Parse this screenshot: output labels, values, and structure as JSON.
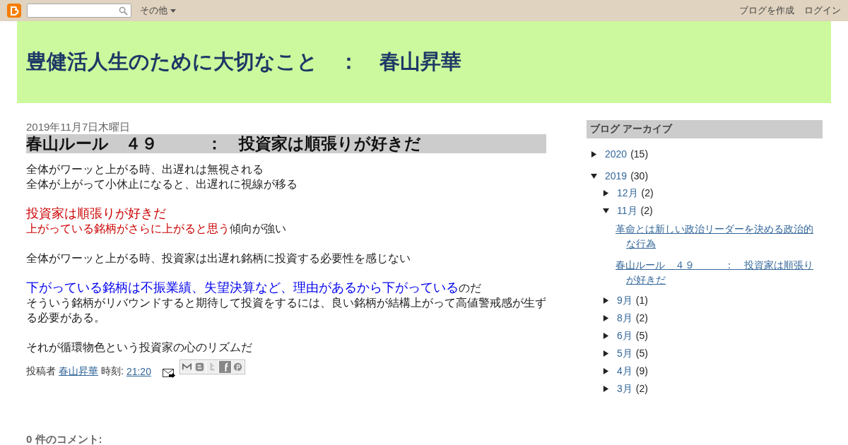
{
  "navbar": {
    "more": "その他",
    "links": [
      "ブログを作成",
      "ログイン"
    ]
  },
  "header": {
    "title": "豊健活人生のために大切なこと　：　春山昇華"
  },
  "post": {
    "date": "2019年11月7日木曜日",
    "title": "春山ルール　４９　　　：　投資家は順張りが好きだ",
    "paragraphs": [
      [
        [
          {
            "text": "全体がワーッと上がる時、出遅れは無視される",
            "kind": "plain"
          }
        ],
        [
          {
            "text": "全体が上がって小休止になると、出遅れに視線が移る",
            "kind": "plain"
          }
        ]
      ],
      [
        [
          {
            "text": "投資家は順張りが好きだ",
            "kind": "accent",
            "color": "#cc0000"
          }
        ],
        [
          {
            "text": "上がっている銘柄がさらに上がると思う",
            "kind": "colored",
            "color": "#cc0000"
          },
          {
            "text": "傾向が強い",
            "kind": "plain"
          }
        ]
      ],
      [
        [
          {
            "text": "全体がワーッと上がる時、投資家は出遅れ銘柄に投資する必要性を感じない",
            "kind": "plain"
          }
        ]
      ],
      [
        [
          {
            "text": "下がっている銘柄は不振業績、失望決算など、理由があるから下がっている",
            "kind": "accent",
            "color": "#0000ee"
          },
          {
            "text": "のだ",
            "kind": "plain"
          }
        ],
        [
          {
            "text": "そういう銘柄がリバウンドすると期待して投資をするには、良い銘柄が結構上がって高値警戒感が生ずる必要がある。",
            "kind": "plain"
          }
        ]
      ],
      [
        [
          {
            "text": "それが循環物色という投資家の心のリズムだ",
            "kind": "plain"
          }
        ]
      ]
    ],
    "footer": {
      "posted_by": "投稿者",
      "author": "春山昇華",
      "time_label": "時刻:",
      "time": "21:20"
    }
  },
  "comments": {
    "heading": "0 件のコメント:"
  },
  "sidebar": {
    "heading": "ブログ アーカイブ",
    "archive": [
      {
        "label": "2020",
        "count": "(15)",
        "expanded": false
      },
      {
        "label": "2019",
        "count": "(30)",
        "expanded": true,
        "children": [
          {
            "label": "12月",
            "count": "(2)",
            "expanded": false
          },
          {
            "label": "11月",
            "count": "(2)",
            "expanded": true,
            "posts": [
              "革命とは新しい政治リーダーを決める政治的な行為",
              "春山ルール　４９　　　：　投資家は順張りが好きだ"
            ]
          },
          {
            "label": "9月",
            "count": "(1)",
            "expanded": false
          },
          {
            "label": "8月",
            "count": "(2)",
            "expanded": false
          },
          {
            "label": "6月",
            "count": "(5)",
            "expanded": false
          },
          {
            "label": "5月",
            "count": "(5)",
            "expanded": false
          },
          {
            "label": "4月",
            "count": "(9)",
            "expanded": false
          },
          {
            "label": "3月",
            "count": "(2)",
            "expanded": false
          }
        ]
      }
    ]
  }
}
